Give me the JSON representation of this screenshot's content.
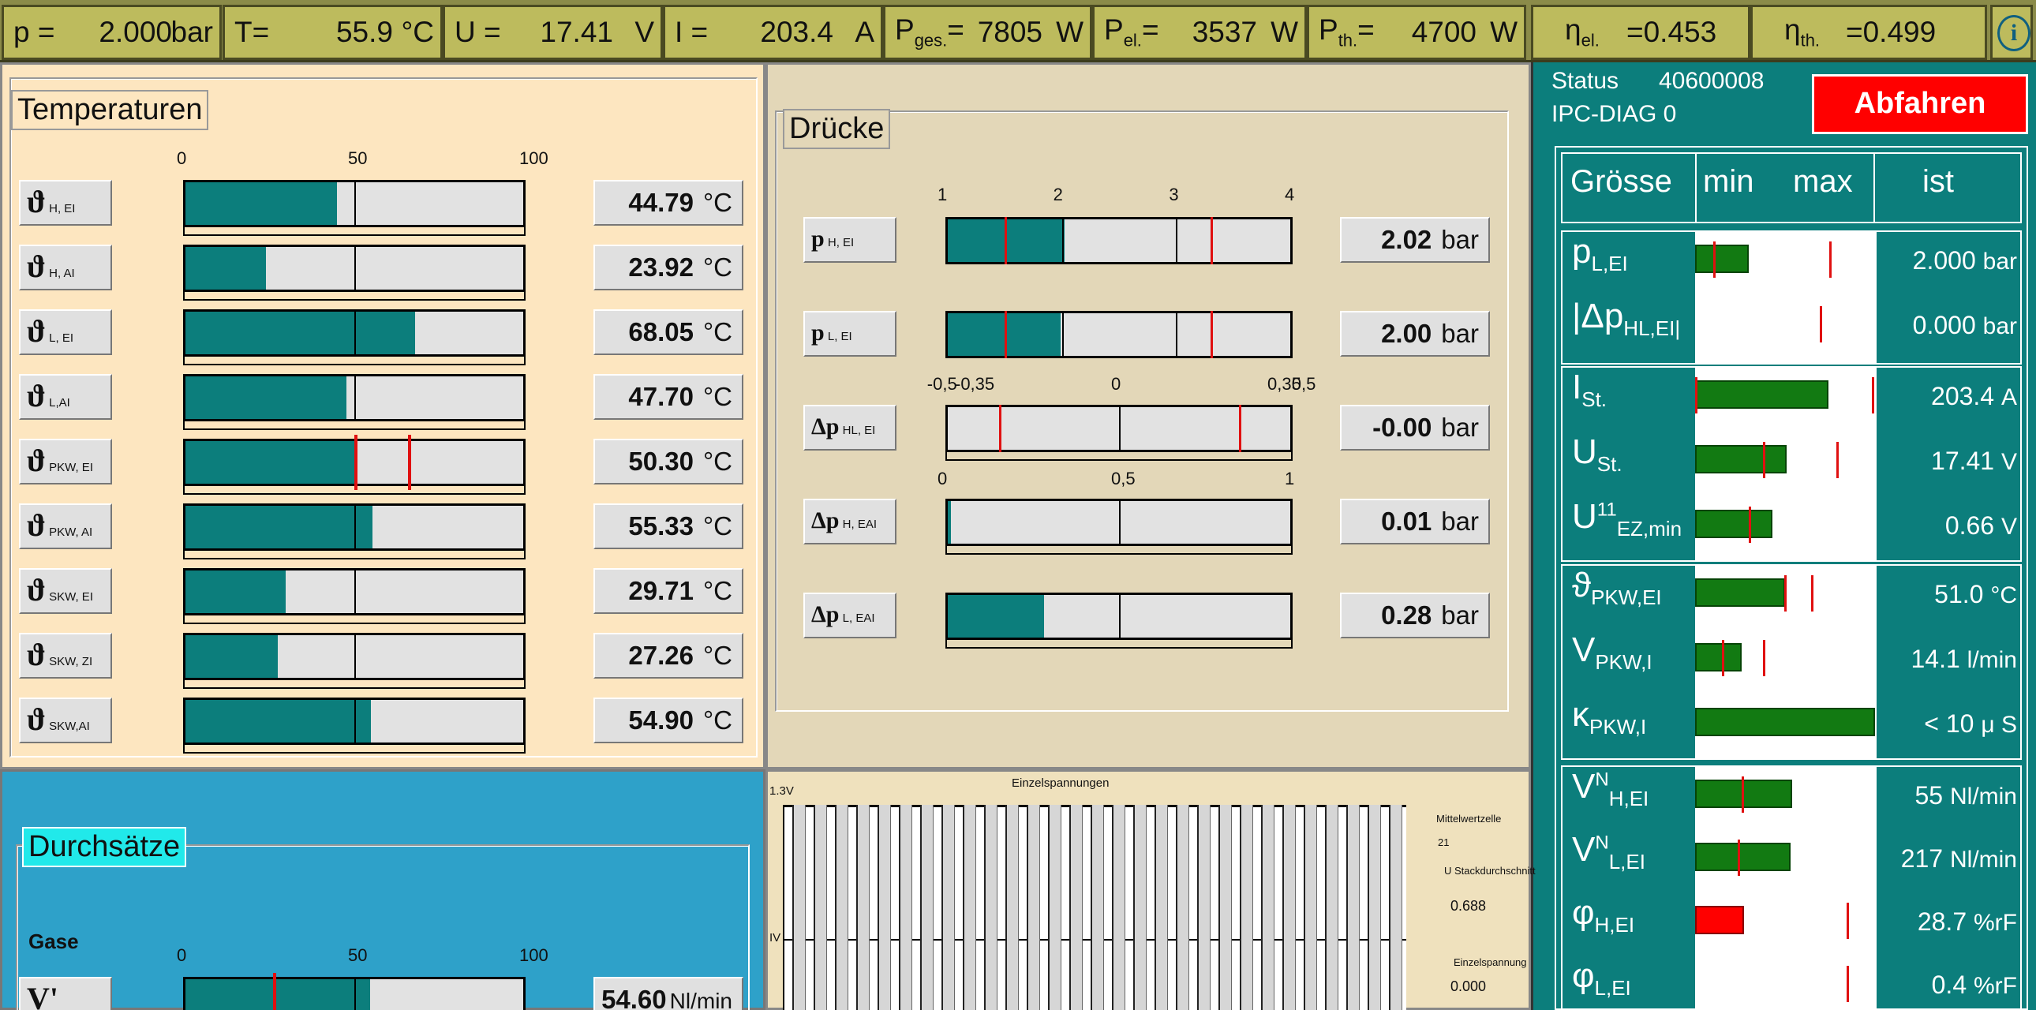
{
  "topbar": {
    "cells": [
      {
        "label": "p =",
        "value": "2.000",
        "unit": "bar"
      },
      {
        "label": "T=",
        "value": "55.9",
        "unit": "°C"
      },
      {
        "label": "U =",
        "value": "17.41",
        "unit": "V"
      },
      {
        "label": "I =",
        "value": "203.4",
        "unit": "A"
      },
      {
        "label": "P",
        "sub": "ges.",
        "eq": "=",
        "value": "7805",
        "unit": "W"
      },
      {
        "label": "P",
        "sub": "el.",
        "eq": "=",
        "value": "3537",
        "unit": "W"
      },
      {
        "label": "P",
        "sub": "th.",
        "eq": "=",
        "value": "4700",
        "unit": "W"
      }
    ],
    "eta_el": {
      "label": "η",
      "sub": "el.",
      "value": "=0.453"
    },
    "eta_th": {
      "label": "η",
      "sub": "th.",
      "value": "=0.499"
    },
    "info_icon": "info-icon",
    "info_glyph": "i"
  },
  "temperatures": {
    "title": "Temperaturen",
    "scale": [
      "0",
      "50",
      "100"
    ],
    "rows": [
      {
        "symbol": "ϑ",
        "sub": "H, EI",
        "fill": 44.79,
        "value": "44.79",
        "unit": "°C"
      },
      {
        "symbol": "ϑ",
        "sub": "H, AI",
        "fill": 23.92,
        "value": "23.92",
        "unit": "°C"
      },
      {
        "symbol": "ϑ",
        "sub": "L, EI",
        "fill": 68.05,
        "value": "68.05",
        "unit": "°C"
      },
      {
        "symbol": "ϑ",
        "sub": "L,AI",
        "fill": 47.7,
        "value": "47.70",
        "unit": "°C"
      },
      {
        "symbol": "ϑ",
        "sub": "PKW, EI",
        "fill": 50.3,
        "value": "50.30",
        "unit": "°C",
        "marks": [
          50,
          66
        ]
      },
      {
        "symbol": "ϑ",
        "sub": "PKW, AI",
        "fill": 55.33,
        "value": "55.33",
        "unit": "°C"
      },
      {
        "symbol": "ϑ",
        "sub": "SKW, EI",
        "fill": 29.71,
        "value": "29.71",
        "unit": "°C"
      },
      {
        "symbol": "ϑ",
        "sub": "SKW, ZI",
        "fill": 27.26,
        "value": "27.26",
        "unit": "°C"
      },
      {
        "symbol": "ϑ",
        "sub": "SKW,AI",
        "fill": 54.9,
        "value": "54.90",
        "unit": "°C"
      }
    ]
  },
  "druecke": {
    "title": "Drücke",
    "scale_p": [
      "1",
      "2",
      "3",
      "4"
    ],
    "scale_dp1": [
      "-0,5",
      "-0,35",
      "0",
      "0,35",
      "0,5"
    ],
    "scale_dp2": [
      "0",
      "0,5",
      "1"
    ],
    "rows": [
      {
        "symbol": "p",
        "sub": "H, EI",
        "fill_frac": 0.34,
        "value": "2.02",
        "unit": "bar",
        "marks": [
          1.5,
          3.3
        ]
      },
      {
        "symbol": "p",
        "sub": "L, EI",
        "fill_frac": 0.33,
        "value": "2.00",
        "unit": "bar",
        "marks": [
          1.5,
          3.3
        ]
      },
      {
        "symbol": "Δp",
        "sub": "HL, EI",
        "fill_frac": 0,
        "value": "-0.00",
        "unit": "bar",
        "marks": [
          -0.35,
          0.35
        ]
      },
      {
        "symbol": "Δp",
        "sub": "H, EAI",
        "fill_frac": 0.01,
        "value": "0.01",
        "unit": "bar"
      },
      {
        "symbol": "Δp",
        "sub": "L, EAI",
        "fill_frac": 0.28,
        "value": "0.28",
        "unit": "bar"
      }
    ]
  },
  "durchsaetze": {
    "title": "Durchsätze",
    "gase_label": "Gase",
    "scale": [
      "0",
      "50",
      "100"
    ],
    "row": {
      "symbol": "V'",
      "fill": 54.6,
      "value": "54.60",
      "unit": "Nl/min",
      "mark": 26
    }
  },
  "einzelspannungen": {
    "title": "Einzelspannungen",
    "y_top": "1.3V",
    "y_mid": "IV",
    "mittelwert_label": "Mittelwertzelle",
    "mittelwert_value": "21",
    "stack_label": "U Stackdurchschnitt",
    "stack_value": "0.688",
    "einzel_label": "Einzelspannung",
    "einzel_value": "0.000"
  },
  "right": {
    "status_label": "Status",
    "status_value": "40600008",
    "diag": "IPC-DIAG 0",
    "abfahren": "Abfahren",
    "hdr_groesse": "Grösse",
    "hdr_min": "min",
    "hdr_max": "max",
    "hdr_ist": "ist",
    "groups": [
      [
        {
          "sym": "p",
          "sub": "L,EI",
          "fill": 0.3,
          "red": [
            0.1,
            0.75
          ],
          "value": "2.000",
          "unit": "bar"
        },
        {
          "sym": "|Δp",
          "sub": "HL,EI|",
          "fill": 0,
          "red": [
            0.7
          ],
          "value": "0.000",
          "unit": "bar"
        }
      ],
      [
        {
          "sym": "I",
          "sub": "St.",
          "fill": 0.74,
          "red": [
            0.0,
            0.99
          ],
          "value": "203.4",
          "unit": "A"
        },
        {
          "sym": "U",
          "sub": "St.",
          "fill": 0.51,
          "red": [
            0.38,
            0.79
          ],
          "value": "17.41",
          "unit": "V"
        },
        {
          "sym": "U",
          "sub": "EZ,min",
          "sup": "11",
          "fill": 0.43,
          "red": [
            0.3
          ],
          "value": "0.66",
          "unit": "V"
        }
      ],
      [
        {
          "sym": "ϑ",
          "sub": "PKW,EI",
          "fill": 0.5,
          "red": [
            0.5,
            0.65
          ],
          "value": "51.0",
          "unit": "°C"
        },
        {
          "sym": "V",
          "sub": "PKW,I",
          "fill": 0.26,
          "red": [
            0.15,
            0.38
          ],
          "value": "14.1",
          "unit": "l/min"
        },
        {
          "sym": "κ",
          "sub": "PKW,I",
          "fill": 1.0,
          "red": [],
          "value": "< 10",
          "unit": "μ S"
        }
      ],
      [
        {
          "sym": "V",
          "sup": "N",
          "sub": "H,EI",
          "fill": 0.54,
          "red": [
            0.26
          ],
          "value": "55",
          "unit": "Nl/min"
        },
        {
          "sym": "V",
          "sup": "N",
          "sub": "L,EI",
          "fill": 0.53,
          "red": [
            0.24
          ],
          "value": "217",
          "unit": "Nl/min"
        },
        {
          "sym": "φ",
          "sub": "H,EI",
          "fill": 0.27,
          "red": [
            0.85
          ],
          "value": "28.7",
          "unit": "%rF",
          "bar_color": "#ff0000"
        },
        {
          "sym": "φ",
          "sub": "L,EI",
          "fill": 0,
          "red": [
            0.85
          ],
          "value": "0.4",
          "unit": "%rF"
        }
      ]
    ]
  },
  "colors": {
    "teal": "#0c7e7c",
    "green": "#127a12",
    "red": "#e01010",
    "olive": "#bdbb5d"
  }
}
